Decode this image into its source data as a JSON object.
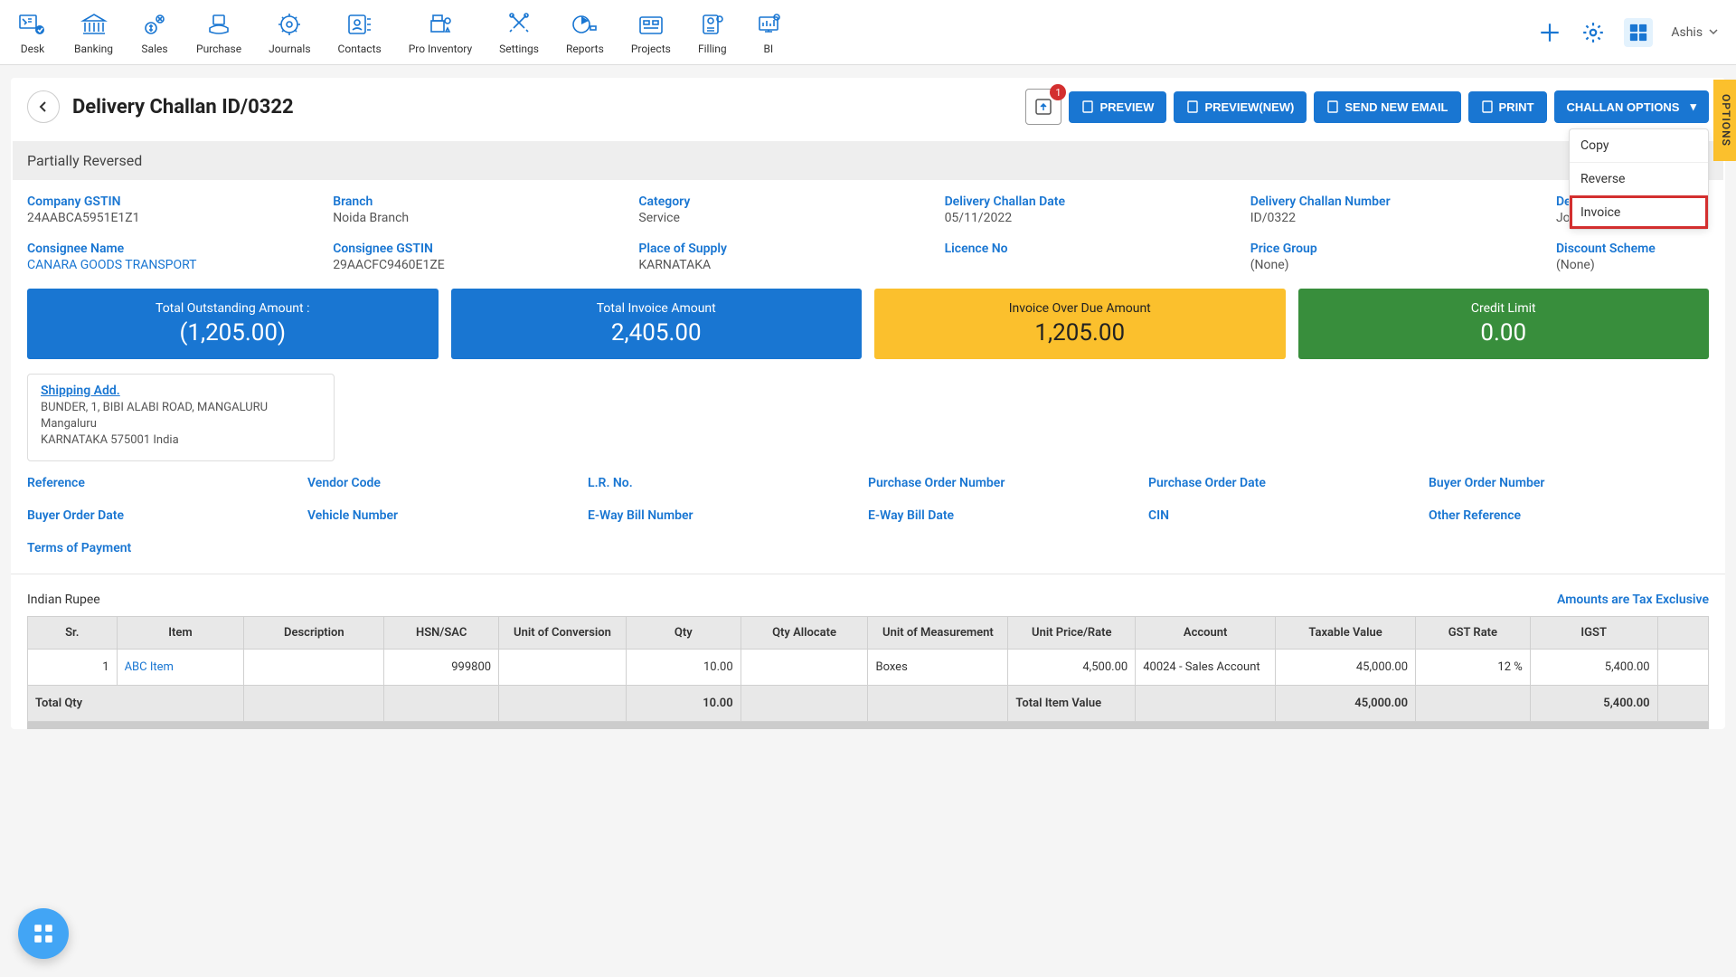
{
  "nav": {
    "items": [
      "Desk",
      "Banking",
      "Sales",
      "Purchase",
      "Journals",
      "Contacts",
      "Pro Inventory",
      "Settings",
      "Reports",
      "Projects",
      "Filling",
      "BI"
    ],
    "user": "Ashis"
  },
  "page": {
    "title": "Delivery Challan ID/0322",
    "upload_badge": "1",
    "buttons": {
      "preview": "PREVIEW",
      "preview_new": "PREVIEW(NEW)",
      "send_email": "SEND NEW EMAIL",
      "print": "PRINT",
      "challan_options": "CHALLAN OPTIONS"
    },
    "dropdown": {
      "copy": "Copy",
      "reverse": "Reverse",
      "invoice": "Invoice"
    },
    "options_tab": "OPTIONS",
    "status": "Partially Reversed"
  },
  "details1": {
    "company_gstin_label": "Company GSTIN",
    "company_gstin": "24AABCA5951E1Z1",
    "branch_label": "Branch",
    "branch": "Noida Branch",
    "category_label": "Category",
    "category": "Service",
    "date_label": "Delivery Challan Date",
    "date": "05/11/2022",
    "number_label": "Delivery Challan Number",
    "number": "ID/0322",
    "dctype_label": "Delivery C",
    "dctype": "Job Work"
  },
  "details2": {
    "consignee_name_label": "Consignee Name",
    "consignee_name": "CANARA GOODS TRANSPORT",
    "consignee_gstin_label": "Consignee GSTIN",
    "consignee_gstin": "29AACFC9460E1ZE",
    "place_label": "Place of Supply",
    "place": "KARNATAKA",
    "licence_label": "Licence No",
    "licence": "",
    "price_group_label": "Price Group",
    "price_group": "(None)",
    "discount_label": "Discount Scheme",
    "discount": "(None)"
  },
  "stats": {
    "outstanding_label": "Total Outstanding Amount :",
    "outstanding": "(1,205.00)",
    "invoice_label": "Total Invoice Amount",
    "invoice": "2,405.00",
    "overdue_label": "Invoice Over Due Amount",
    "overdue": "1,205.00",
    "credit_label": "Credit Limit",
    "credit": "0.00"
  },
  "shipping": {
    "title": "Shipping Add.",
    "line1": "BUNDER, 1, BIBI ALABI ROAD, MANGALURU Mangaluru",
    "line2": "KARNATAKA 575001 India"
  },
  "refs": {
    "reference": "Reference",
    "vendor_code": "Vendor Code",
    "lr_no": "L.R. No.",
    "po_number": "Purchase Order Number",
    "po_date": "Purchase Order Date",
    "buyer_order_number": "Buyer Order Number",
    "buyer_order_date": "Buyer Order Date",
    "vehicle_number": "Vehicle Number",
    "eway_number": "E-Way Bill Number",
    "eway_date": "E-Way Bill Date",
    "cin": "CIN",
    "other_ref": "Other Reference",
    "terms": "Terms of Payment"
  },
  "currency": {
    "name": "Indian Rupee",
    "note": "Amounts are Tax Exclusive"
  },
  "table": {
    "headers": {
      "sr": "Sr.",
      "item": "Item",
      "desc": "Description",
      "hsn": "HSN/SAC",
      "uoc": "Unit of Conversion",
      "qty": "Qty",
      "qty_alloc": "Qty Allocate",
      "uom": "Unit of Measurement",
      "rate": "Unit Price/Rate",
      "account": "Account",
      "taxable": "Taxable Value",
      "gst_rate": "GST Rate",
      "igst": "IGST"
    },
    "row": {
      "sr": "1",
      "item": "ABC Item",
      "desc": "",
      "hsn": "999800",
      "uoc": "",
      "qty": "10.00",
      "qty_alloc": "",
      "uom": "Boxes",
      "rate": "4,500.00",
      "account": "40024 - Sales Account",
      "taxable": "45,000.00",
      "gst_rate": "12 %",
      "igst": "5,400.00"
    },
    "footer": {
      "label": "Total Qty",
      "qty": "10.00",
      "total_item_label": "Total Item Value",
      "taxable": "45,000.00",
      "igst": "5,400.00"
    }
  }
}
